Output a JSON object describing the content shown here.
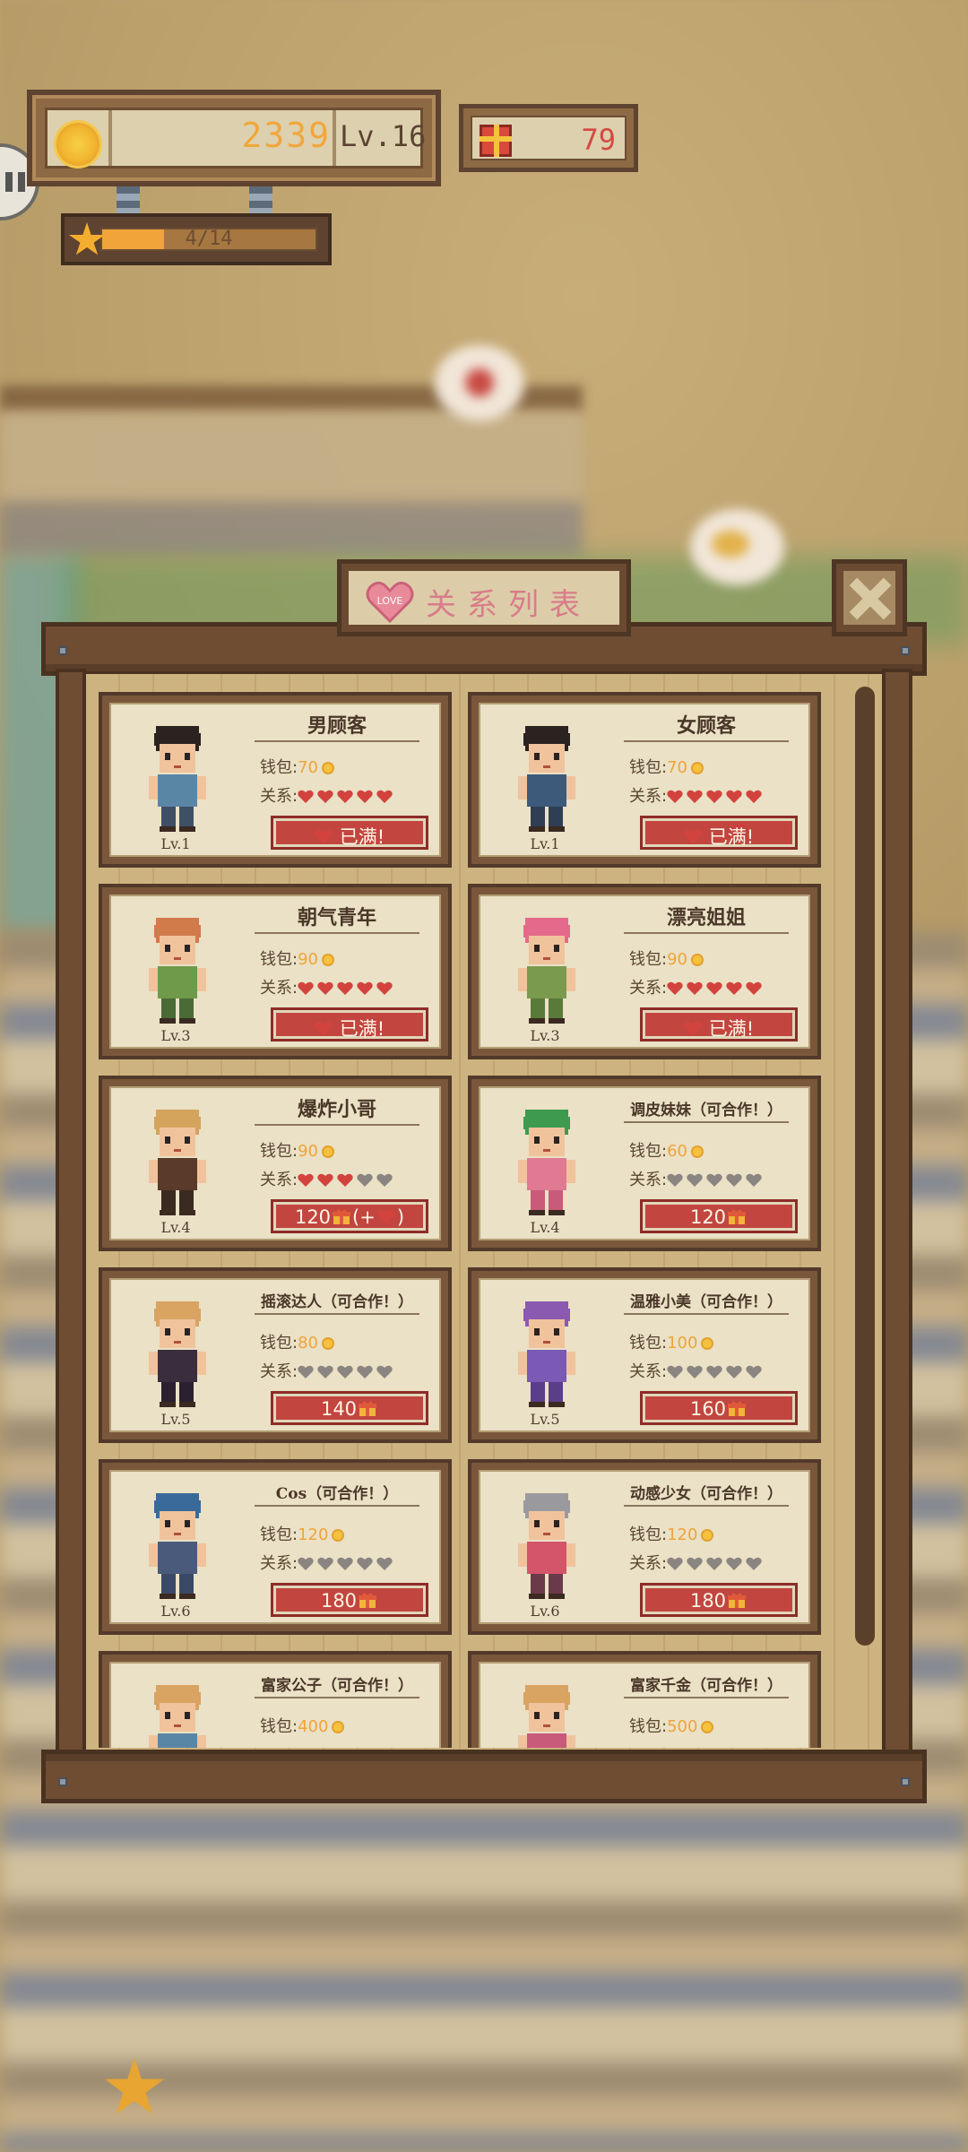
{
  "hud": {
    "coins": "2339",
    "level": "Lv.16",
    "gifts": "79",
    "star_progress_text": "4/14",
    "star_progress": 0.29
  },
  "modal": {
    "badge": "LOVE",
    "title": "关系列表"
  },
  "labels": {
    "wallet": "钱包:",
    "relation": "关系:"
  },
  "colors": {
    "heart_full": "#d3433e",
    "heart_empty": "#8a8580",
    "coin": "#f0a43a"
  },
  "customers": [
    {
      "name": "男顾客",
      "level": "Lv.1",
      "wallet": "70",
      "hearts": 5,
      "action": "已满!",
      "status": "full",
      "avatar": {
        "hair": "#2b2320",
        "shirt": "#5a86a6",
        "pants": "#3e4f66",
        "skin": "#f0c39c"
      }
    },
    {
      "name": "女顾客",
      "level": "Lv.1",
      "wallet": "70",
      "hearts": 5,
      "action": "已满!",
      "status": "full",
      "avatar": {
        "hair": "#2b2320",
        "shirt": "#3e5a7a",
        "pants": "#2f3e55",
        "skin": "#f0c39c"
      }
    },
    {
      "name": "朝气青年",
      "level": "Lv.3",
      "wallet": "90",
      "hearts": 5,
      "action": "已满!",
      "status": "full",
      "avatar": {
        "hair": "#d17a4a",
        "shirt": "#6e9a4a",
        "pants": "#4a6a36",
        "skin": "#f0c39c"
      }
    },
    {
      "name": "漂亮姐姐",
      "level": "Lv.3",
      "wallet": "90",
      "hearts": 5,
      "action": "已满!",
      "status": "full",
      "avatar": {
        "hair": "#e46a8c",
        "shirt": "#7a9a4e",
        "pants": "#5a7a3a",
        "skin": "#f0c39c"
      }
    },
    {
      "name": "爆炸小哥",
      "level": "Lv.4",
      "wallet": "90",
      "hearts": 3,
      "action": "120",
      "action_suffix": "(+",
      "action_end": ")",
      "status": "gift_plus",
      "avatar": {
        "hair": "#d4a35c",
        "shirt": "#5a3a2a",
        "pants": "#3a2a20",
        "skin": "#f0c39c"
      }
    },
    {
      "name": "调皮妹妹（可合作！）",
      "level": "Lv.4",
      "wallet": "60",
      "hearts": 0,
      "action": "120",
      "status": "gift",
      "avatar": {
        "hair": "#3e9a4e",
        "shirt": "#e07a92",
        "pants": "#c85a7a",
        "skin": "#f0c39c"
      }
    },
    {
      "name": "摇滚达人（可合作！）",
      "level": "Lv.5",
      "wallet": "80",
      "hearts": 0,
      "action": "140",
      "status": "gift",
      "avatar": {
        "hair": "#d9a362",
        "shirt": "#3a2e3e",
        "pants": "#2a2030",
        "skin": "#f0c39c"
      }
    },
    {
      "name": "温雅小美（可合作！）",
      "level": "Lv.5",
      "wallet": "100",
      "hearts": 0,
      "action": "160",
      "status": "gift",
      "avatar": {
        "hair": "#8a5ab0",
        "shirt": "#7a5ab5",
        "pants": "#5a3e8a",
        "skin": "#f0c39c"
      }
    },
    {
      "name": "Cos（可合作！）",
      "level": "Lv.6",
      "wallet": "120",
      "hearts": 0,
      "action": "180",
      "status": "gift",
      "avatar": {
        "hair": "#3a6a9a",
        "shirt": "#4a5a7a",
        "pants": "#3a4a66",
        "skin": "#f0c39c"
      }
    },
    {
      "name": "动感少女（可合作！）",
      "level": "Lv.6",
      "wallet": "120",
      "hearts": 0,
      "action": "180",
      "status": "gift",
      "avatar": {
        "hair": "#9a9a9e",
        "shirt": "#d4546a",
        "pants": "#6a3a4a",
        "skin": "#f0c39c"
      }
    },
    {
      "name": "富家公子（可合作！）",
      "level": "",
      "wallet": "400",
      "hearts": 0,
      "action": "",
      "status": "partial",
      "avatar": {
        "hair": "#d9a362",
        "shirt": "#5a86a6",
        "pants": "#3e4f66",
        "skin": "#f0c39c"
      }
    },
    {
      "name": "富家千金（可合作！）",
      "level": "",
      "wallet": "500",
      "hearts": 0,
      "action": "",
      "status": "partial",
      "avatar": {
        "hair": "#d9a362",
        "shirt": "#c85a7a",
        "pants": "#6a3a4a",
        "skin": "#f0c39c"
      }
    }
  ]
}
